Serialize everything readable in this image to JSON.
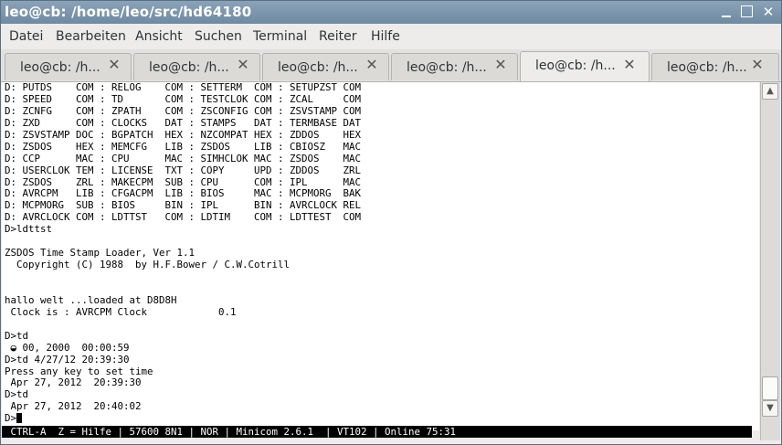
{
  "window": {
    "title": "leo@cb: /home/leo/src/hd64180"
  },
  "menubar": {
    "items": [
      "Datei",
      "Bearbeiten",
      "Ansicht",
      "Suchen",
      "Terminal",
      "Reiter",
      "Hilfe"
    ]
  },
  "tabs": [
    {
      "label": "leo@cb: /h...",
      "active": false
    },
    {
      "label": "leo@cb: /h...",
      "active": false
    },
    {
      "label": "leo@cb: /h...",
      "active": false
    },
    {
      "label": "leo@cb: /h...",
      "active": false
    },
    {
      "label": "leo@cb: /h...",
      "active": true
    },
    {
      "label": "leo@cb: /h...",
      "active": false
    }
  ],
  "terminal": {
    "lines": [
      "D: PUTDS    COM : RELOG    COM : SETTERM  COM : SETUPZST COM",
      "D: SPEED    COM : TD       COM : TESTCLOK COM : ZCAL     COM",
      "D: ZCNFG    COM : ZPATH    COM : ZSCONFIG COM : ZSVSTAMP COM",
      "D: ZXD      COM : CLOCKS   DAT : STAMPS   DAT : TERMBASE DAT",
      "D: ZSVSTAMP DOC : BGPATCH  HEX : NZCOMPAT HEX : ZDDOS    HEX",
      "D: ZSDOS    HEX : MEMCFG   LIB : ZSDOS    LIB : CBIOSZ   MAC",
      "D: CCP      MAC : CPU      MAC : SIMHCLOK MAC : ZSDOS    MAC",
      "D: USERCLOK TEM : LICENSE  TXT : COPY     UPD : ZDDOS    ZRL",
      "D: ZSDOS    ZRL : MAKECPM  SUB : CPU      COM : IPL      MAC",
      "D: AVRCPM   LIB : CFGACPM  LIB : BIOS     MAC : MCPMORG  BAK",
      "D: MCPMORG  SUB : BIOS     BIN : IPL      BIN : AVRCLOCK REL",
      "D: AVRCLOCK COM : LDTTST   COM : LDTIM    COM : LDTTEST  COM",
      "D>ldttst",
      "",
      "ZSDOS Time Stamp Loader, Ver 1.1",
      "  Copyright (C) 1988  by H.F.Bower / C.W.Cotrill",
      "",
      "",
      "hallo welt ...loaded at D8D8H",
      " Clock is : AVRCPM Clock            0.1",
      "",
      "D>td",
      " \u0000 00, 2000  00:00:59",
      "D>td 4/27/12 20:39:30",
      "Press any key to set time",
      " Apr 27, 2012  20:39:30",
      "D>td",
      " Apr 27, 2012  20:40:02",
      "D>"
    ],
    "glyph_note_line": 22
  },
  "statusline": {
    "text": " CTRL-A  Z = Hilfe | 57600 8N1 | NOR | Minicom 2.6.1  | VT102 | Online 75:31"
  },
  "scrollbar": {
    "up_icon": "chevron-up-icon",
    "down_icon": "chevron-down-icon"
  }
}
